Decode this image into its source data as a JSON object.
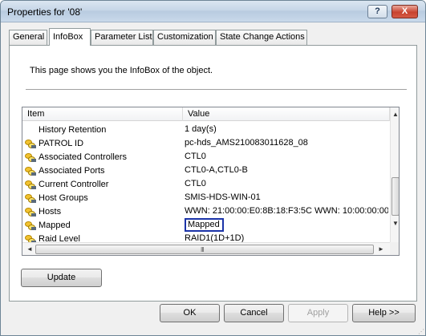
{
  "window": {
    "title": "Properties for '08'"
  },
  "titlebar": {
    "help_label": "?",
    "close_label": "X"
  },
  "tabs": [
    {
      "label": "General"
    },
    {
      "label": "InfoBox"
    },
    {
      "label": "Parameter List"
    },
    {
      "label": "Customization"
    },
    {
      "label": "State Change Actions"
    }
  ],
  "panel": {
    "description": "This page shows you the InfoBox of the object."
  },
  "list": {
    "columns": [
      "Item",
      "Value"
    ],
    "rows": [
      {
        "item": "History Retention",
        "value": "1 day(s)"
      },
      {
        "item": "PATROL ID",
        "value": "pc-hds_AMS210083011628_08"
      },
      {
        "item": "Associated Controllers",
        "value": "CTL0"
      },
      {
        "item": "Associated Ports",
        "value": "CTL0-A,CTL0-B"
      },
      {
        "item": "Current Controller",
        "value": "CTL0"
      },
      {
        "item": "Host Groups",
        "value": "SMIS-HDS-WIN-01"
      },
      {
        "item": "Hosts",
        "value": "WWN: 21:00:00:E0:8B:18:F3:5C  WWN: 10:00:00:00"
      },
      {
        "item": "Mapped",
        "value": "Mapped"
      },
      {
        "item": "Raid Level",
        "value": "RAID1(1D+1D)"
      }
    ]
  },
  "scrollbar": {
    "up": "▲",
    "down": "▼",
    "left": "◄",
    "right": "►",
    "grip": "III"
  },
  "buttons": {
    "update": "Update",
    "ok": "OK",
    "cancel": "Cancel",
    "apply": "Apply",
    "help": "Help >>"
  }
}
